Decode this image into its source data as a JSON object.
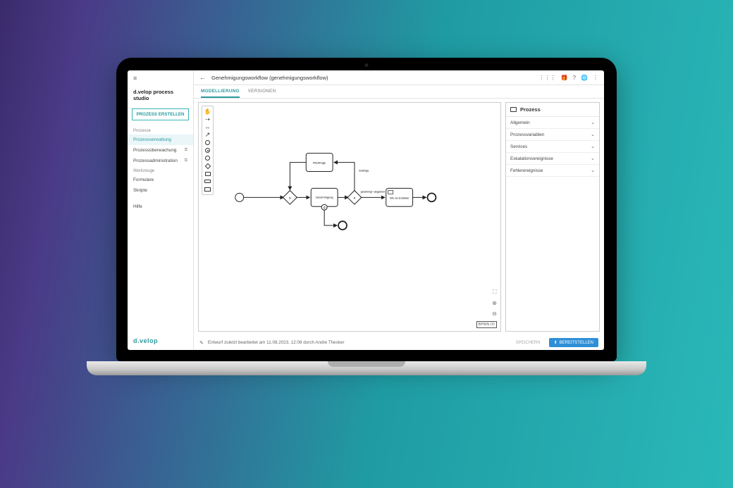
{
  "sidebar": {
    "app_title": "d.velop process studio",
    "create_button": "PROZESS ERSTELLEN",
    "section_processes": "Prozesse",
    "items_processes": [
      {
        "label": "Prozessverwaltung",
        "active": true,
        "ext": false
      },
      {
        "label": "Prozessüberwachung",
        "active": false,
        "ext": true
      },
      {
        "label": "Prozessadministration",
        "active": false,
        "ext": true
      }
    ],
    "section_tools": "Werkzeuge",
    "items_tools": [
      {
        "label": "Formulare"
      },
      {
        "label": "Skripte"
      }
    ],
    "help": "Hilfe",
    "brand": "d.velop"
  },
  "header": {
    "title": "Genehmigungsworkflow (genehmigungsworkflow)"
  },
  "tabs": {
    "modellierung": "MODELLIERUNG",
    "versionen": "VERSIONEN"
  },
  "diagram": {
    "node_rueckfrage": "Rückfrage",
    "node_genehmigung": "Genehmigung",
    "node_info": "Info an Ersteller",
    "label_rueckfrage": "rückfrage",
    "label_genehmigt": "genehmigt / abgelehnt"
  },
  "canvas": {
    "bpmn_badge": "BPMN.IO"
  },
  "panel": {
    "title": "Prozess",
    "rows": [
      "Allgemein",
      "Prozessvariablen",
      "Services",
      "Eskalationsereignisse",
      "Fehlerereignisse"
    ]
  },
  "footer": {
    "status": "Entwurf zuletzt bearbeitet am 11.08.2023, 12:08 durch Andre Thesker",
    "save": "SPEICHERN",
    "publish": "BEREITSTELLEN"
  }
}
